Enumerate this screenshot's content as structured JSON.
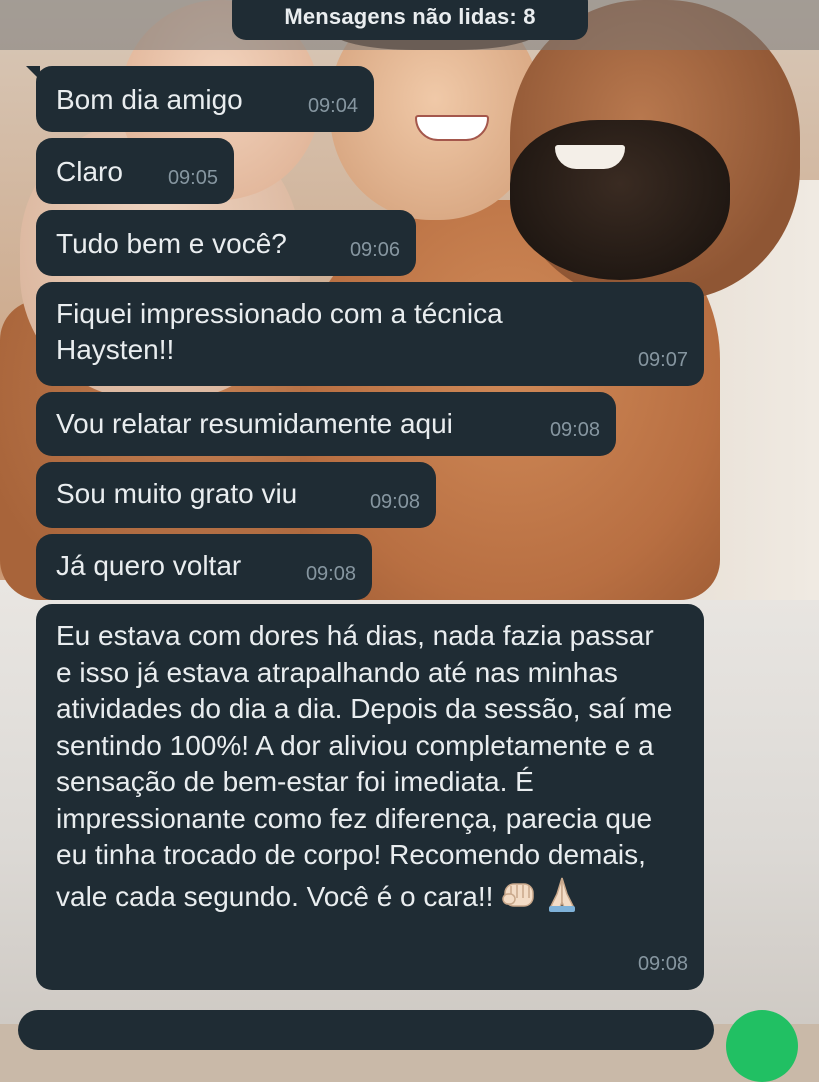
{
  "header": {
    "unread_label": "Mensagens não lidas: 8"
  },
  "messages": [
    {
      "text": "Bom dia amigo",
      "time": "09:04"
    },
    {
      "text": "Claro",
      "time": "09:05"
    },
    {
      "text": "Tudo bem e você?",
      "time": "09:06"
    },
    {
      "text": "Fiquei impressionado com a técnica Haysten!!",
      "time": "09:07"
    },
    {
      "text": "Vou relatar resumidamente aqui",
      "time": "09:08"
    },
    {
      "text": "Sou muito grato viu",
      "time": "09:08"
    },
    {
      "text": "Já quero voltar",
      "time": "09:08"
    },
    {
      "text": "Eu estava com dores há dias, nada fazia passar e isso já estava atrapalhando até nas minhas atividades do dia a dia. Depois da sessão, saí me sentindo 100%! A dor aliviou completamente e a sensação de bem-estar foi imediata. É impressionante como fez diferença, parecia que eu tinha trocado de corpo! Recomendo demais, vale cada segundo. Você é o cara!!",
      "time": "09:08",
      "emojis": [
        "fist-bump-icon",
        "praying-hands-icon"
      ]
    }
  ],
  "colors": {
    "bubble_bg": "#1f2c34",
    "bubble_text": "#e9edef",
    "timestamp": "#8696a0",
    "send_button": "#21c063"
  }
}
